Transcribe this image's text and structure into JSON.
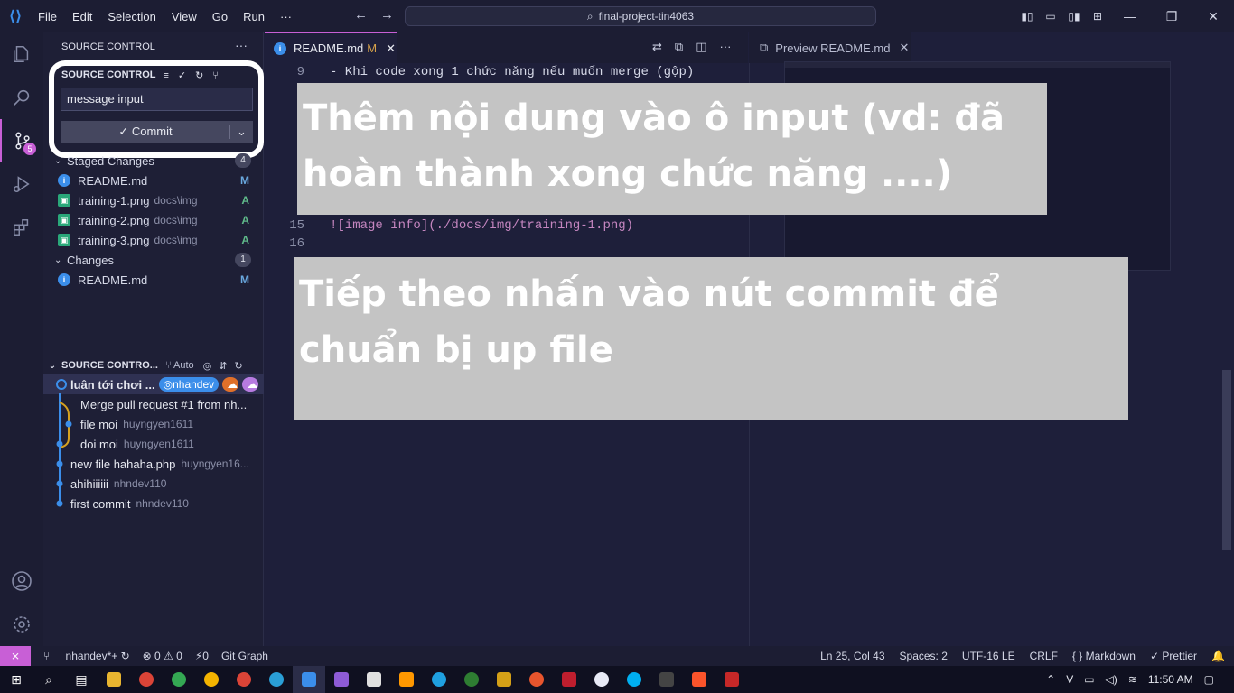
{
  "titlebar": {
    "menu": [
      "File",
      "Edit",
      "Selection",
      "View",
      "Go",
      "Run",
      "···"
    ],
    "search": "final-project-tin4063"
  },
  "sidebar": {
    "title": "SOURCE CONTROL",
    "section_label": "SOURCE CONTROL",
    "message_value": "message input",
    "commit_label": "Commit",
    "staged": {
      "label": "Staged Changes",
      "count": "4",
      "files": [
        {
          "name": "README.md",
          "dir": "",
          "status": "M"
        },
        {
          "name": "training-1.png",
          "dir": "docs\\img",
          "status": "A"
        },
        {
          "name": "training-2.png",
          "dir": "docs\\img",
          "status": "A"
        },
        {
          "name": "training-3.png",
          "dir": "docs\\img",
          "status": "A"
        }
      ]
    },
    "changes": {
      "label": "Changes",
      "count": "1",
      "files": [
        {
          "name": "README.md",
          "dir": "",
          "status": "M"
        }
      ]
    },
    "scm_badge": "5"
  },
  "graph": {
    "title": "SOURCE CONTRO...",
    "auto": "Auto",
    "commits": [
      {
        "msg": "luân tới chơi ...",
        "author": "",
        "tag": "nhandev"
      },
      {
        "msg": "Merge pull request #1 from nh...",
        "author": ""
      },
      {
        "msg": "file moi",
        "author": "huyngyen1611"
      },
      {
        "msg": "doi moi",
        "author": "huyngyen1611"
      },
      {
        "msg": "new file hahaha.php",
        "author": "huyngyen16..."
      },
      {
        "msg": "ahihiiiiii",
        "author": "nhndev110"
      },
      {
        "msg": "first commit",
        "author": "nhndev110"
      }
    ]
  },
  "editor": {
    "tab_label": "README.md",
    "tab_status": "M",
    "lines": [
      {
        "n": "9",
        "text": "- Khi code xong 1 chức năng nếu muốn merge (gộp)"
      },
      {
        "n": "15",
        "text": "![image info](./docs/img/training-1.png)"
      },
      {
        "n": "16",
        "text": ""
      }
    ]
  },
  "preview": {
    "tab_label": "Preview README.md"
  },
  "overlays": {
    "first": "Thêm nội dung vào ô input (vd: đã hoàn thành xong chức năng ....)",
    "second": "Tiếp theo nhấn vào nút commit để chuẩn bị up file"
  },
  "statusbar": {
    "branch": "nhandev*+",
    "problems": "⊗ 0 ⚠ 0",
    "ports": "⚡0",
    "git_graph": "Git Graph",
    "position": "Ln 25, Col 43",
    "spaces": "Spaces: 2",
    "encoding": "UTF-16 LE",
    "eol": "CRLF",
    "language": "Markdown",
    "prettier": "✓ Prettier"
  },
  "taskbar": {
    "time": "11:50 AM"
  },
  "colors": {
    "accent": "#c85fd6",
    "overlay_bg": "#c4c4c4"
  }
}
